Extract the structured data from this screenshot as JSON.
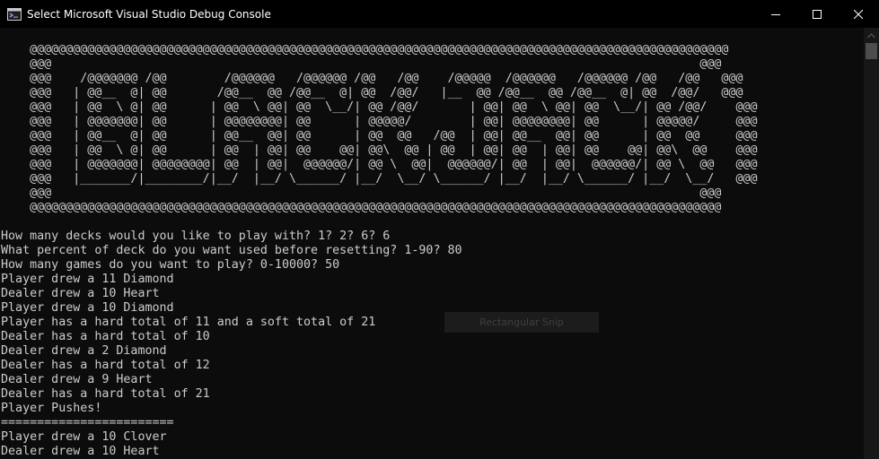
{
  "window": {
    "title": "Select Microsoft Visual Studio Debug Console",
    "app_icon": "console-app-icon",
    "buttons": [
      {
        "name": "minimize-button",
        "icon": "minimize-icon"
      },
      {
        "name": "maximize-button",
        "icon": "maximize-icon"
      },
      {
        "name": "close-button",
        "icon": "close-icon"
      }
    ]
  },
  "console": {
    "lines": [
      "    @@@@@@@@@@@@@@@@@@@@@@@@@@@@@@@@@@@@@@@@@@@@@@@@@@@@@@@@@@@@@@@@@@@@@@@@@@@@@@@@@@@@@@@@@@@@@@@@@",
      "    @@@                                                                                          @@@",
      "    @@@    /@@@@@@@ /@@        /@@@@@@   /@@@@@@ /@@   /@@    /@@@@@  /@@@@@@   /@@@@@@ /@@   /@@   @@@",
      "    @@@   | @@__  @| @@       /@@__  @@ /@@__  @| @@  /@@/   |__  @@ /@@__  @@ /@@__  @| @@  /@@/   @@@",
      "    @@@   | @@  \\ @| @@      | @@  \\ @@| @@  \\__/| @@ /@@/       | @@| @@  \\ @@| @@  \\__/| @@ /@@/    @@@",
      "    @@@   | @@@@@@@| @@      | @@@@@@@@| @@      | @@@@@/        | @@| @@@@@@@@| @@      | @@@@@/     @@@",
      "    @@@   | @@__  @| @@      | @@__  @@| @@      | @@  @@   /@@  | @@| @@__  @@| @@      | @@  @@     @@@",
      "    @@@   | @@  \\ @| @@      | @@  | @@| @@    @@| @@\\  @@ | @@  | @@| @@  | @@| @@    @@| @@\\  @@    @@@",
      "    @@@   | @@@@@@@| @@@@@@@@| @@  | @@|  @@@@@@/| @@ \\  @@|  @@@@@@/| @@  | @@|  @@@@@@/| @@ \\  @@   @@@",
      "    @@@   |_______/|________/|__/  |__/ \\______/ |__/  \\__/ \\______/ |__/  |__/ \\______/ |__/  \\__/   @@@",
      "    @@@                                                                                          @@@",
      "    @@@@@@@@@@@@@@@@@@@@@@@@@@@@@@@@@@@@@@@@@@@@@@@@@@@@@@@@@@@@@@@@@@@@@@@@@@@@@@@@@@@@@@@@@@@@@@@@",
      "",
      "How many decks would you like to play with? 1? 2? 6? 6",
      "What percent of deck do you want used before resetting? 1-90? 80",
      "How many games do you want to play? 0-10000? 50",
      "Player drew a 11 Diamond",
      "Dealer drew a 10 Heart",
      "Player drew a 10 Diamond",
      "Player has a hard total of 11 and a soft total of 21",
      "Dealer has a hard total of 10",
      "Dealer drew a 2 Diamond",
      "Dealer has a hard total of 12",
      "Dealer drew a 9 Heart",
      "Dealer has a hard total of 21",
      "Player Pushes!",
      "========================",
      "Player drew a 10 Clover",
      "Dealer drew a 10 Heart"
    ]
  },
  "tooltip": {
    "label": "Rectangular Snip"
  },
  "colors": {
    "background": "#0c0c0c",
    "text": "#cccccc",
    "titlebar": "#000000",
    "scrollbar_track": "#171717",
    "scrollbar_thumb": "#4d4d4d"
  }
}
